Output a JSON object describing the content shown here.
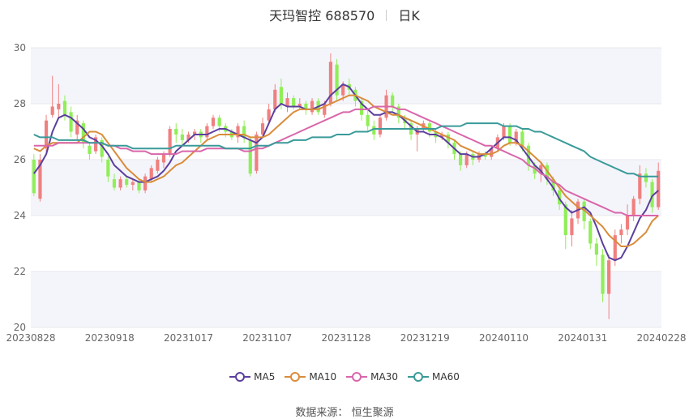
{
  "title": {
    "name": "天玛智控 688570",
    "period": "日K"
  },
  "source": {
    "label": "数据来源：",
    "value": "恒生聚源"
  },
  "colors": {
    "up": "#f08080",
    "down": "#90ee58",
    "grid": "#e8e8ee",
    "band": "#f4f5fb"
  },
  "chart_data": {
    "type": "candlestick",
    "ylim": [
      20,
      30
    ],
    "yticks": [
      20,
      22,
      24,
      26,
      28,
      30
    ],
    "x_tick_labels": [
      "20230828",
      "20230918",
      "20231017",
      "20231107",
      "20231128",
      "20231219",
      "20240110",
      "20240131",
      "20240228"
    ],
    "candles": [
      [
        26.0,
        24.8,
        26.2,
        24.7
      ],
      [
        24.6,
        26.0,
        26.2,
        24.5
      ],
      [
        26.4,
        27.4,
        27.6,
        26.2
      ],
      [
        27.6,
        27.9,
        29.0,
        27.5
      ],
      [
        27.8,
        28.0,
        28.7,
        27.5
      ],
      [
        28.1,
        27.6,
        28.3,
        27.4
      ],
      [
        27.7,
        27.0,
        27.9,
        26.8
      ],
      [
        26.9,
        27.4,
        27.6,
        26.7
      ],
      [
        27.3,
        26.6,
        27.4,
        26.4
      ],
      [
        26.5,
        26.2,
        26.6,
        26.0
      ],
      [
        26.3,
        26.8,
        26.9,
        26.2
      ],
      [
        26.7,
        26.1,
        26.8,
        25.9
      ],
      [
        26.0,
        25.4,
        26.1,
        25.2
      ],
      [
        25.3,
        25.0,
        25.5,
        24.9
      ],
      [
        25.0,
        25.3,
        25.4,
        24.9
      ],
      [
        25.3,
        25.1,
        25.4,
        25.0
      ],
      [
        25.1,
        25.2,
        25.3,
        24.9
      ],
      [
        25.2,
        24.9,
        25.3,
        24.8
      ],
      [
        24.9,
        25.4,
        25.5,
        24.8
      ],
      [
        25.3,
        25.7,
        25.8,
        25.2
      ],
      [
        25.6,
        26.0,
        26.1,
        25.5
      ],
      [
        25.9,
        26.2,
        26.3,
        25.7
      ],
      [
        26.2,
        27.1,
        27.2,
        26.1
      ],
      [
        27.1,
        26.9,
        27.3,
        26.6
      ],
      [
        26.9,
        26.7,
        27.1,
        26.5
      ],
      [
        26.7,
        26.9,
        27.0,
        26.6
      ],
      [
        26.9,
        27.0,
        27.1,
        26.7
      ],
      [
        27.0,
        26.8,
        27.1,
        26.6
      ],
      [
        26.8,
        27.2,
        27.3,
        26.7
      ],
      [
        27.2,
        27.5,
        27.6,
        27.1
      ],
      [
        27.5,
        27.2,
        27.6,
        27.0
      ],
      [
        27.2,
        27.0,
        27.3,
        26.8
      ],
      [
        27.0,
        26.8,
        27.1,
        26.7
      ],
      [
        26.8,
        27.2,
        27.3,
        26.6
      ],
      [
        27.2,
        26.8,
        27.4,
        26.6
      ],
      [
        26.7,
        25.5,
        26.8,
        25.4
      ],
      [
        25.6,
        26.9,
        27.0,
        25.5
      ],
      [
        26.9,
        27.3,
        27.5,
        26.8
      ],
      [
        27.4,
        27.8,
        28.0,
        27.3
      ],
      [
        27.8,
        28.5,
        28.7,
        27.7
      ],
      [
        28.6,
        28.0,
        28.9,
        27.8
      ],
      [
        27.9,
        28.2,
        28.4,
        27.7
      ],
      [
        28.2,
        27.9,
        28.3,
        27.8
      ],
      [
        27.9,
        28.0,
        28.2,
        27.8
      ],
      [
        28.0,
        27.8,
        28.1,
        27.6
      ],
      [
        27.7,
        28.1,
        28.2,
        27.6
      ],
      [
        28.1,
        27.7,
        28.2,
        27.6
      ],
      [
        27.6,
        28.0,
        28.1,
        27.5
      ],
      [
        28.0,
        29.5,
        29.8,
        27.9
      ],
      [
        29.4,
        28.3,
        29.6,
        28.1
      ],
      [
        28.3,
        28.7,
        28.8,
        28.1
      ],
      [
        28.7,
        28.5,
        28.9,
        28.3
      ],
      [
        28.5,
        28.1,
        28.6,
        27.9
      ],
      [
        28.1,
        27.6,
        28.2,
        27.4
      ],
      [
        27.6,
        27.2,
        27.8,
        27.0
      ],
      [
        27.2,
        26.9,
        27.4,
        26.7
      ],
      [
        26.9,
        27.5,
        27.6,
        26.8
      ],
      [
        27.5,
        28.3,
        28.5,
        27.4
      ],
      [
        28.3,
        27.9,
        28.4,
        27.7
      ],
      [
        27.9,
        27.5,
        28.0,
        27.3
      ],
      [
        27.5,
        27.3,
        27.6,
        27.1
      ],
      [
        27.3,
        26.9,
        27.4,
        26.7
      ],
      [
        26.9,
        27.1,
        27.2,
        26.3
      ],
      [
        27.1,
        27.3,
        27.4,
        27.0
      ],
      [
        27.3,
        27.0,
        27.4,
        26.8
      ],
      [
        27.0,
        26.8,
        27.1,
        26.6
      ],
      [
        26.8,
        26.9,
        27.0,
        26.7
      ],
      [
        26.9,
        26.6,
        27.0,
        26.4
      ],
      [
        26.6,
        26.2,
        26.7,
        26.0
      ],
      [
        26.2,
        25.8,
        26.3,
        25.6
      ],
      [
        25.8,
        26.2,
        26.3,
        25.7
      ],
      [
        26.2,
        26.0,
        26.3,
        25.8
      ],
      [
        26.0,
        26.2,
        26.3,
        25.9
      ],
      [
        26.2,
        26.1,
        26.3,
        26.0
      ],
      [
        26.1,
        26.4,
        26.5,
        26.0
      ],
      [
        26.4,
        26.8,
        26.9,
        26.3
      ],
      [
        26.8,
        27.2,
        27.3,
        26.7
      ],
      [
        27.2,
        26.6,
        27.3,
        26.5
      ],
      [
        26.6,
        27.0,
        27.1,
        26.5
      ],
      [
        27.0,
        26.5,
        27.1,
        26.3
      ],
      [
        26.5,
        25.8,
        26.6,
        25.6
      ],
      [
        25.8,
        25.5,
        25.9,
        25.3
      ],
      [
        25.5,
        25.8,
        25.9,
        25.2
      ],
      [
        25.8,
        25.3,
        25.9,
        25.1
      ],
      [
        25.3,
        24.9,
        25.4,
        24.7
      ],
      [
        24.9,
        24.4,
        25.0,
        24.2
      ],
      [
        24.4,
        23.3,
        24.5,
        22.8
      ],
      [
        23.3,
        23.9,
        24.2,
        22.9
      ],
      [
        23.9,
        24.5,
        24.6,
        23.7
      ],
      [
        24.5,
        23.8,
        24.6,
        23.5
      ],
      [
        23.8,
        23.0,
        23.9,
        22.8
      ],
      [
        23.0,
        22.6,
        23.2,
        22.2
      ],
      [
        22.6,
        21.2,
        22.8,
        20.9
      ],
      [
        21.2,
        22.4,
        22.6,
        20.3
      ],
      [
        22.4,
        23.3,
        23.5,
        22.2
      ],
      [
        23.3,
        23.5,
        23.7,
        23.0
      ],
      [
        23.5,
        24.0,
        24.4,
        23.3
      ],
      [
        24.0,
        24.6,
        24.7,
        23.8
      ],
      [
        24.6,
        25.5,
        25.8,
        24.4
      ],
      [
        25.5,
        25.2,
        25.7,
        25.0
      ],
      [
        25.2,
        24.3,
        25.3,
        24.1
      ],
      [
        24.3,
        25.6,
        25.9,
        24.2
      ]
    ],
    "series": [
      {
        "name": "MA5",
        "color": "#5b3f9e",
        "values": [
          25.5,
          25.8,
          26.2,
          27.0,
          27.5,
          27.6,
          27.5,
          27.3,
          27.1,
          26.8,
          26.7,
          26.5,
          26.2,
          25.8,
          25.6,
          25.4,
          25.3,
          25.2,
          25.2,
          25.3,
          25.4,
          25.6,
          25.9,
          26.3,
          26.5,
          26.7,
          26.9,
          26.9,
          26.9,
          27.0,
          27.1,
          27.1,
          27.0,
          26.9,
          26.8,
          26.7,
          26.6,
          26.8,
          27.3,
          27.8,
          28.0,
          27.9,
          27.9,
          27.9,
          27.8,
          27.8,
          27.9,
          28.0,
          28.3,
          28.5,
          28.7,
          28.6,
          28.3,
          28.0,
          27.8,
          27.6,
          27.6,
          27.7,
          27.7,
          27.6,
          27.4,
          27.2,
          27.0,
          27.0,
          26.9,
          26.9,
          26.8,
          26.6,
          26.4,
          26.2,
          26.2,
          26.1,
          26.1,
          26.2,
          26.4,
          26.6,
          26.8,
          26.8,
          26.7,
          26.4,
          26.1,
          25.8,
          25.6,
          25.3,
          25.0,
          24.6,
          24.3,
          24.1,
          24.2,
          24.3,
          24.1,
          23.6,
          23.0,
          22.5,
          22.4,
          22.5,
          22.9,
          23.4,
          23.9,
          24.2,
          24.7,
          24.9
        ]
      },
      {
        "name": "MA10",
        "color": "#d98c3a",
        "values": [
          26.4,
          26.3,
          26.5,
          26.6,
          26.6,
          26.6,
          26.6,
          26.6,
          26.8,
          27.0,
          27.0,
          26.9,
          26.6,
          26.3,
          26.0,
          25.7,
          25.5,
          25.3,
          25.2,
          25.2,
          25.3,
          25.4,
          25.6,
          25.8,
          25.9,
          26.1,
          26.3,
          26.5,
          26.7,
          26.8,
          26.9,
          26.9,
          26.9,
          26.9,
          26.9,
          26.8,
          26.8,
          26.8,
          26.9,
          27.1,
          27.3,
          27.5,
          27.7,
          27.8,
          27.8,
          27.8,
          27.8,
          27.9,
          28.0,
          28.1,
          28.2,
          28.3,
          28.3,
          28.2,
          28.1,
          27.9,
          27.8,
          27.7,
          27.6,
          27.6,
          27.5,
          27.4,
          27.3,
          27.2,
          27.1,
          27.0,
          26.9,
          26.8,
          26.7,
          26.5,
          26.4,
          26.3,
          26.2,
          26.2,
          26.2,
          26.3,
          26.5,
          26.6,
          26.6,
          26.5,
          26.3,
          26.1,
          25.9,
          25.6,
          25.3,
          25.0,
          24.7,
          24.5,
          24.3,
          24.2,
          24.0,
          23.8,
          23.6,
          23.3,
          23.1,
          22.9,
          22.9,
          23.0,
          23.2,
          23.4,
          23.8,
          24.0
        ]
      },
      {
        "name": "MA30",
        "color": "#d966aa",
        "values": [
          26.5,
          26.5,
          26.5,
          26.5,
          26.6,
          26.6,
          26.6,
          26.6,
          26.6,
          26.6,
          26.6,
          26.6,
          26.5,
          26.5,
          26.4,
          26.4,
          26.3,
          26.3,
          26.3,
          26.2,
          26.2,
          26.2,
          26.2,
          26.2,
          26.3,
          26.3,
          26.3,
          26.3,
          26.4,
          26.4,
          26.4,
          26.4,
          26.4,
          26.4,
          26.3,
          26.3,
          26.4,
          26.4,
          26.5,
          26.6,
          26.7,
          26.8,
          26.9,
          27.0,
          27.1,
          27.2,
          27.3,
          27.4,
          27.5,
          27.6,
          27.7,
          27.7,
          27.8,
          27.8,
          27.8,
          27.9,
          27.9,
          27.9,
          27.9,
          27.8,
          27.8,
          27.7,
          27.6,
          27.5,
          27.4,
          27.3,
          27.2,
          27.1,
          27.0,
          26.9,
          26.8,
          26.7,
          26.6,
          26.5,
          26.5,
          26.4,
          26.3,
          26.2,
          26.1,
          26.0,
          25.8,
          25.7,
          25.5,
          25.4,
          25.2,
          25.1,
          24.9,
          24.8,
          24.7,
          24.6,
          24.5,
          24.4,
          24.3,
          24.2,
          24.1,
          24.1,
          24.0,
          24.0,
          24.0,
          24.0,
          24.0,
          24.0
        ]
      },
      {
        "name": "MA60",
        "color": "#3a9a9a",
        "values": [
          26.9,
          26.8,
          26.8,
          26.8,
          26.7,
          26.7,
          26.7,
          26.7,
          26.7,
          26.6,
          26.6,
          26.6,
          26.5,
          26.5,
          26.5,
          26.5,
          26.4,
          26.4,
          26.4,
          26.4,
          26.4,
          26.4,
          26.4,
          26.5,
          26.5,
          26.5,
          26.5,
          26.5,
          26.5,
          26.5,
          26.5,
          26.4,
          26.4,
          26.4,
          26.4,
          26.4,
          26.5,
          26.5,
          26.5,
          26.6,
          26.6,
          26.6,
          26.7,
          26.7,
          26.7,
          26.8,
          26.8,
          26.8,
          26.8,
          26.9,
          26.9,
          26.9,
          27.0,
          27.0,
          27.0,
          27.1,
          27.1,
          27.1,
          27.1,
          27.1,
          27.1,
          27.1,
          27.1,
          27.1,
          27.1,
          27.1,
          27.2,
          27.2,
          27.2,
          27.2,
          27.3,
          27.3,
          27.3,
          27.3,
          27.3,
          27.3,
          27.2,
          27.2,
          27.2,
          27.1,
          27.1,
          27.0,
          27.0,
          26.9,
          26.8,
          26.7,
          26.6,
          26.5,
          26.4,
          26.3,
          26.1,
          26.0,
          25.9,
          25.8,
          25.7,
          25.6,
          25.5,
          25.5,
          25.4,
          25.4,
          25.4,
          25.4
        ]
      }
    ]
  }
}
